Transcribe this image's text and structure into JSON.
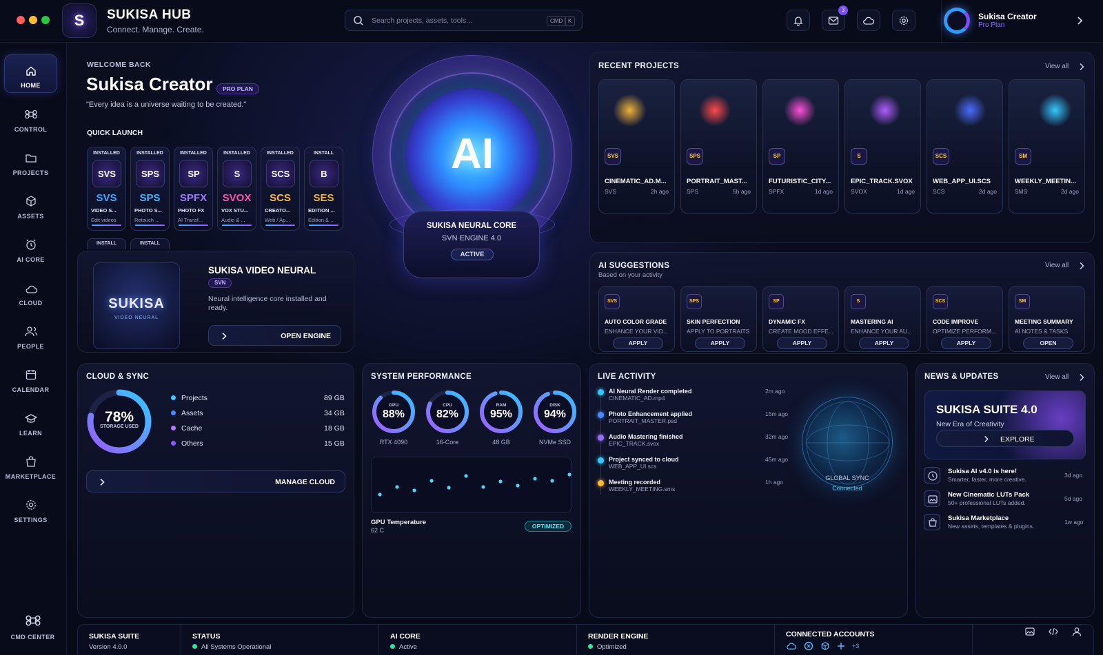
{
  "app": {
    "title": "SUKISA HUB",
    "subtitle": "Connect. Manage. Create.",
    "logo_text": "S"
  },
  "search": {
    "placeholder": "Search projects, assets, tools...",
    "kbd1": "CMD",
    "kbd2": "K"
  },
  "topbar": {
    "mail_badge": "3",
    "icons": [
      "bell-icon",
      "mail-icon",
      "cloud-icon",
      "gear-icon"
    ]
  },
  "profile": {
    "name": "Sukisa Creator",
    "plan": "Pro Plan"
  },
  "sidebar": {
    "items": [
      {
        "label": "HOME",
        "icon": "home-icon",
        "active": true
      },
      {
        "label": "CONTROL",
        "icon": "command-icon"
      },
      {
        "label": "PROJECTS",
        "icon": "folder-icon"
      },
      {
        "label": "ASSETS",
        "icon": "cube-icon"
      },
      {
        "label": "AI CORE",
        "icon": "clock-icon"
      },
      {
        "label": "CLOUD",
        "icon": "cloud-icon"
      },
      {
        "label": "PEOPLE",
        "icon": "people-icon"
      },
      {
        "label": "CALENDAR",
        "icon": "calendar-icon"
      },
      {
        "label": "LEARN",
        "icon": "graduation-icon"
      },
      {
        "label": "MARKETPLACE",
        "icon": "bag-icon"
      },
      {
        "label": "SETTINGS",
        "icon": "gear-icon"
      }
    ],
    "cmd_center": "CMD CENTER"
  },
  "welcome": {
    "kicker": "WELCOME BACK",
    "name": "Sukisa Creator",
    "plan_badge": "PRO PLAN",
    "quote": "\"Every idea is a universe waiting to be created.\""
  },
  "quick_launch": {
    "title": "QUICK LAUNCH",
    "apps": [
      {
        "status": "INSTALLED",
        "icon_text": "SVS",
        "abbr": "SVS",
        "name": "VIDEO S...",
        "desc": "Edit videos",
        "color": "#3aa8ff"
      },
      {
        "status": "INSTALLED",
        "icon_text": "SPS",
        "abbr": "SPS",
        "name": "PHOTO S...",
        "desc": "Retouch ...",
        "color": "#39b6ff"
      },
      {
        "status": "INSTALLED",
        "icon_text": "SP",
        "abbr": "SPFX",
        "name": "PHOTO FX",
        "desc": "AI Transf...",
        "color": "#9b7bff"
      },
      {
        "status": "INSTALLED",
        "icon_text": "S",
        "abbr": "SVOX",
        "name": "VOX STU...",
        "desc": "Audio & ...",
        "color": "#ff4fae"
      },
      {
        "status": "INSTALLED",
        "icon_text": "SCS",
        "abbr": "SCS",
        "name": "CREATO...",
        "desc": "Web / Ap...",
        "color": "#ffb84a"
      },
      {
        "status": "INSTALL",
        "icon_text": "B",
        "abbr": "SES",
        "name": "EDITION ...",
        "desc": "Edition & ...",
        "color": "#f0b040"
      }
    ],
    "more": [
      "INSTALL",
      "INSTALL"
    ]
  },
  "featured": {
    "title": "SUKISA VIDEO NEURAL",
    "tag": "SVN",
    "desc": "Neural intelligence core installed and ready.",
    "button": "OPEN ENGINE",
    "logo_text": "SUKISA",
    "logo_sub": "VIDEO NEURAL"
  },
  "core": {
    "orb_text": "AI",
    "title": "SUKISA NEURAL CORE",
    "engine": "SVN ENGINE 4.0",
    "status": "ACTIVE"
  },
  "recent_projects": {
    "title": "RECENT PROJECTS",
    "view_all": "View all",
    "items": [
      {
        "name": "CINEMATIC_AD.M...",
        "type": "SVS",
        "time": "2h ago",
        "icon": "SVS",
        "glow": "#f0b13a"
      },
      {
        "name": "PORTRAIT_MAST...",
        "type": "SPS",
        "time": "5h ago",
        "icon": "SPS",
        "glow": "#ff4a4a"
      },
      {
        "name": "FUTURISTIC_CITY...",
        "type": "SPFX",
        "time": "1d ago",
        "icon": "SP",
        "glow": "#ff4fd8"
      },
      {
        "name": "EPIC_TRACK.SVOX",
        "type": "SVOX",
        "time": "1d ago",
        "icon": "S",
        "glow": "#b05cff"
      },
      {
        "name": "WEB_APP_UI.SCS",
        "type": "SCS",
        "time": "2d ago",
        "icon": "SCS",
        "glow": "#4a6cff"
      },
      {
        "name": "WEEKLY_MEETIN...",
        "type": "SMS",
        "time": "2d ago",
        "icon": "SM",
        "glow": "#35c7ff"
      }
    ]
  },
  "ai_suggestions": {
    "title": "AI SUGGESTIONS",
    "subtitle": "Based on your activity",
    "view_all": "View all",
    "items": [
      {
        "name": "AUTO COLOR GRADE",
        "desc": "ENHANCE YOUR VID...",
        "button": "APPLY",
        "icon": "SVS"
      },
      {
        "name": "SKIN PERFECTION",
        "desc": "APPLY TO PORTRAITS",
        "button": "APPLY",
        "icon": "SPS"
      },
      {
        "name": "DYNAMIC FX",
        "desc": "CREATE MOOD EFFE...",
        "button": "APPLY",
        "icon": "SP"
      },
      {
        "name": "MASTERING AI",
        "desc": "ENHANCE YOUR AU...",
        "button": "APPLY",
        "icon": "S"
      },
      {
        "name": "CODE IMPROVE",
        "desc": "OPTIMIZE PERFORM...",
        "button": "APPLY",
        "icon": "SCS"
      },
      {
        "name": "MEETING SUMMARY",
        "desc": "AI NOTES & TASKS",
        "button": "OPEN",
        "icon": "SM"
      }
    ]
  },
  "cloud": {
    "title": "CLOUD & SYNC",
    "percent": "78%",
    "percent_value": 0.78,
    "percent_label": "STORAGE USED",
    "legend": [
      {
        "label": "Projects",
        "value": "89 GB",
        "color": "#3ac8ff"
      },
      {
        "label": "Assets",
        "value": "34 GB",
        "color": "#4a8cff"
      },
      {
        "label": "Cache",
        "value": "18 GB",
        "color": "#b27aff"
      },
      {
        "label": "Others",
        "value": "15 GB",
        "color": "#8a5cff"
      }
    ],
    "button": "MANAGE CLOUD"
  },
  "performance": {
    "title": "SYSTEM PERFORMANCE",
    "gauges": [
      {
        "label": "GPU",
        "value": "88%",
        "fraction": 0.88,
        "sub": "RTX 4090"
      },
      {
        "label": "CPU",
        "value": "82%",
        "fraction": 0.82,
        "sub": "16-Core"
      },
      {
        "label": "RAM",
        "value": "95%",
        "fraction": 0.95,
        "sub": "48 GB"
      },
      {
        "label": "DISK",
        "value": "94%",
        "fraction": 0.94,
        "sub": "NVMe SSD"
      }
    ],
    "temp_label": "GPU Temperature",
    "temp_value": "62 C",
    "temp_status": "OPTIMIZED"
  },
  "activity": {
    "title": "LIVE ACTIVITY",
    "items": [
      {
        "title": "AI Neural Render completed",
        "file": "CINEMATIC_AD.mp4",
        "time": "2m ago",
        "color": "#35c7ff"
      },
      {
        "title": "Photo Enhancement applied",
        "file": "PORTRAIT_MASTER.psd",
        "time": "15m ago",
        "color": "#4a8cff"
      },
      {
        "title": "Audio Mastering finished",
        "file": "EPIC_TRACK.svox",
        "time": "32m ago",
        "color": "#9b6bff"
      },
      {
        "title": "Project synced to cloud",
        "file": "WEB_APP_UI.scs",
        "time": "45m ago",
        "color": "#35c7ff"
      },
      {
        "title": "Meeting recorded",
        "file": "WEEKLY_MEETING.sms",
        "time": "1h ago",
        "color": "#ffb838"
      }
    ],
    "globe_label": "GLOBAL SYNC",
    "globe_status": "Connected"
  },
  "news": {
    "title": "NEWS & UPDATES",
    "view_all": "View all",
    "hero_title": "SUKISA SUITE 4.0",
    "hero_sub": "New Era of Creativity",
    "hero_button": "EXPLORE",
    "items": [
      {
        "title": "Sukisa AI v4.0 is here!",
        "desc": "Smarter, faster, more creative.",
        "time": "3d ago",
        "icon": "clock-icon"
      },
      {
        "title": "New Cinematic LUTs Pack",
        "desc": "50+ professional LUTs added.",
        "time": "5d ago",
        "icon": "image-icon"
      },
      {
        "title": "Sukisa Marketplace",
        "desc": "New assets, templates & plugins.",
        "time": "1w ago",
        "icon": "bag-icon"
      }
    ]
  },
  "footer": {
    "suite_title": "SUKISA SUITE",
    "suite_version": "Version 4.0.0",
    "status_title": "STATUS",
    "status_value": "All Systems Operational",
    "core_title": "AI CORE",
    "core_value": "Active",
    "render_title": "RENDER ENGINE",
    "render_value": "Optimized",
    "accounts_title": "CONNECTED ACCOUNTS",
    "accounts_more": "+3"
  }
}
